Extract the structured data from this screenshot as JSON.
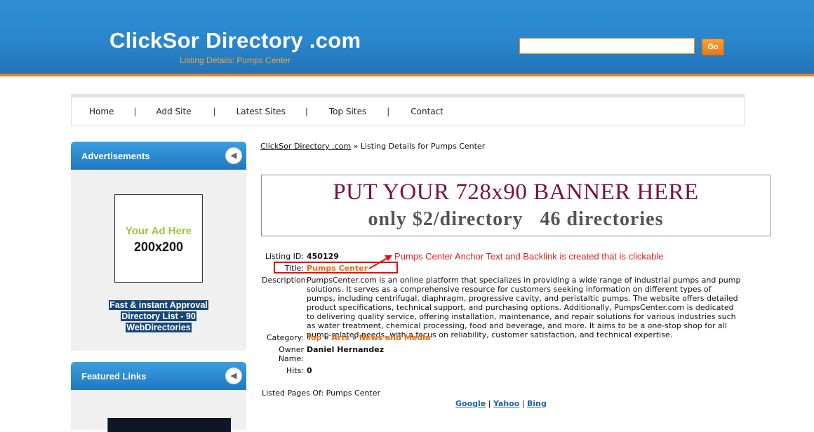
{
  "header": {
    "site_title": "ClickSor Directory .com",
    "subtitle": "Listing Details: Pumps Center",
    "search_placeholder": "",
    "go_label": "Go"
  },
  "nav": {
    "items": [
      "Home",
      "Add Site",
      "Latest Sites",
      "Top Sites",
      "Contact"
    ],
    "separator": "|"
  },
  "sidebar": {
    "advertisements": {
      "title": "Advertisements",
      "ad_line1": "Your Ad Here",
      "ad_line2": "200x200",
      "promo_lines": [
        "Fast & instant Approval",
        "Directory List - 90",
        "WebDirectories"
      ]
    },
    "featured": {
      "title": "Featured Links"
    }
  },
  "breadcrumb": {
    "home": "ClickSor Directory .com",
    "sep": "»",
    "current": "Listing Details for Pumps Center"
  },
  "banner": {
    "line1": "PUT YOUR 728x90 BANNER HERE",
    "line2": "only $2/directory   46 directories"
  },
  "listing": {
    "id_label": "Listing ID:",
    "id_value": "450129",
    "title_label": "Title:",
    "title_value": "Pumps Center",
    "desc_label": "Description:",
    "desc_value": "PumpsCenter.com is an online platform that specializes in providing a wide range of industrial pumps and pump solutions. It serves as a comprehensive resource for customers seeking information on different types of pumps, including centrifugal, diaphragm, progressive cavity, and peristaltic pumps. The website offers detailed product specifications, technical support, and purchasing options. Additionally, PumpsCenter.com is dedicated to delivering quality service, offering installation, maintenance, and repair solutions for various industries such as water treatment, chemical processing, food and beverage, and more. It aims to be a one-stop shop for all pump-related needs, with a focus on reliability, customer satisfaction, and technical expertise.",
    "category_label": "Category:",
    "category_path": [
      "Top",
      "Arts",
      "News and Media"
    ],
    "category_sep": "»",
    "owner_label_1": "Owner",
    "owner_label_2": "Name:",
    "owner_value": "Daniel Hernandez",
    "hits_label": "Hits:",
    "hits_value": "0",
    "listed_pages": "Listed Pages Of: Pumps Center"
  },
  "annotation": {
    "text": "Pumps Center Anchor Text and Backlink is created that is clickable",
    "color": "#e02020"
  },
  "search_engines": {
    "items": [
      "Google",
      "Yahoo",
      "Bing"
    ],
    "sep": "|"
  },
  "colors": {
    "header_blue": "#2a86cc",
    "accent_orange": "#f07c1c",
    "link_orange": "#e66b0c",
    "banner_maroon": "#7a1040"
  }
}
